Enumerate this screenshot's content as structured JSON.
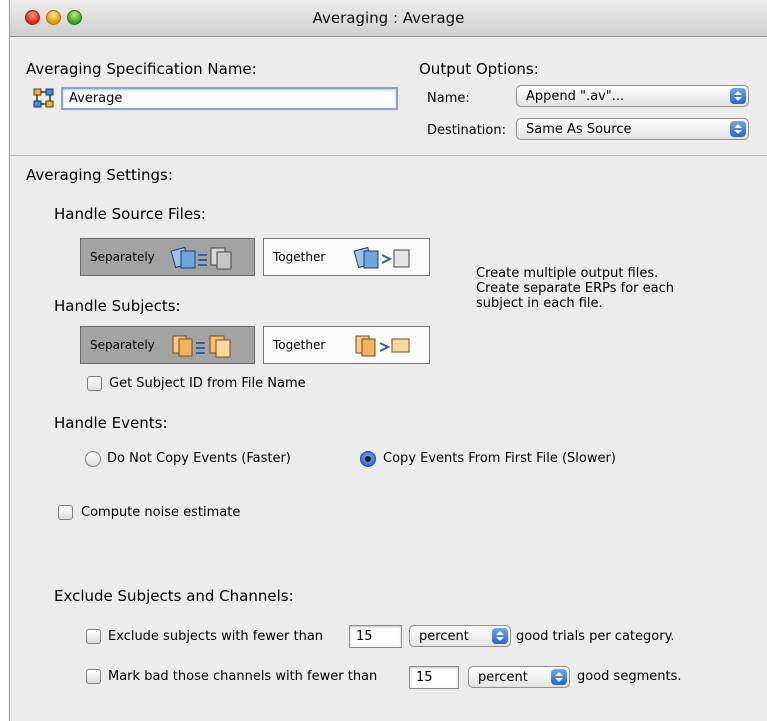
{
  "window": {
    "title": "Averaging : Average"
  },
  "spec": {
    "label": "Averaging Specification Name:",
    "icon": "network-icon",
    "value": "Average"
  },
  "output": {
    "label": "Output Options:",
    "name_label": "Name:",
    "name_value": "Append \".av\"...",
    "dest_label": "Destination:",
    "dest_value": "Same As Source"
  },
  "settings": {
    "label": "Averaging Settings:"
  },
  "source_files": {
    "label": "Handle Source Files:",
    "separately": "Separately",
    "together": "Together",
    "selected": "separately"
  },
  "description": {
    "line1": "Create multiple output files.",
    "line2": "Create separate ERPs for each",
    "line3": "subject in each file."
  },
  "subjects": {
    "label": "Handle Subjects:",
    "separately": "Separately",
    "together": "Together",
    "selected": "separately",
    "subject_id_label": "Get Subject ID from File Name",
    "subject_id_checked": false
  },
  "events": {
    "label": "Handle Events:",
    "option1": "Do Not Copy Events (Faster)",
    "option2": "Copy Events From First File (Slower)",
    "selected": "option2"
  },
  "noise": {
    "label": "Compute noise estimate",
    "checked": false
  },
  "exclude": {
    "label": "Exclude Subjects and Channels:",
    "subjects_prefix": "Exclude subjects with fewer than",
    "subjects_value": "15",
    "subjects_unit": "percent",
    "subjects_suffix": "good trials per category.",
    "subjects_checked": false,
    "channels_prefix": "Mark bad those channels with fewer than",
    "channels_value": "15",
    "channels_unit": "percent",
    "channels_suffix": "good segments.",
    "channels_checked": false
  },
  "colors": {
    "accent": "#2a6cd6",
    "selected_segment": "#a3a3a3",
    "window_bg": "#ececec"
  }
}
